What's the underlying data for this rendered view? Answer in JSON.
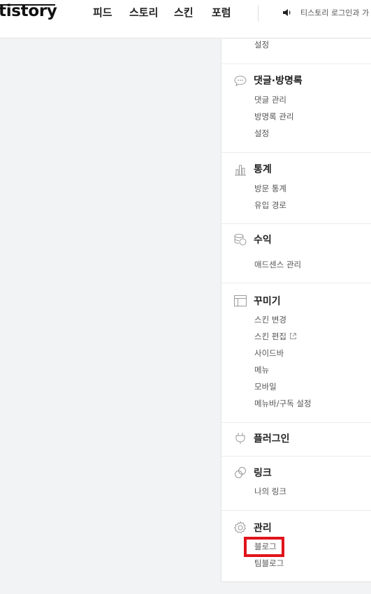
{
  "header": {
    "logo": "tistory",
    "nav": [
      "피드",
      "스토리",
      "스킨",
      "포럼"
    ],
    "notice": "티스토리 로그인과 가"
  },
  "sidebar": {
    "top_item": "설정",
    "sections": [
      {
        "title": "댓글·방명록",
        "icon": "speech-bubble-icon",
        "items": [
          "댓글 관리",
          "방명록 관리",
          "설정"
        ]
      },
      {
        "title": "통계",
        "icon": "bar-chart-icon",
        "items": [
          "방문 통계",
          "유입 경로"
        ]
      },
      {
        "title": "수익",
        "icon": "coins-icon",
        "items": [
          "애드센스 관리"
        ]
      },
      {
        "title": "꾸미기",
        "icon": "layout-icon",
        "items": [
          "스킨 변경",
          "스킨 편집",
          "사이드바",
          "메뉴",
          "모바일",
          "메뉴바/구독 설정"
        ]
      },
      {
        "title": "플러그인",
        "icon": "plug-icon",
        "items": []
      },
      {
        "title": "링크",
        "icon": "link-icon",
        "items": [
          "나의 링크"
        ]
      },
      {
        "title": "관리",
        "icon": "gear-icon",
        "items": [
          "블로그",
          "팀블로그"
        ]
      }
    ]
  },
  "colors": {
    "highlight": "#e0141b"
  }
}
